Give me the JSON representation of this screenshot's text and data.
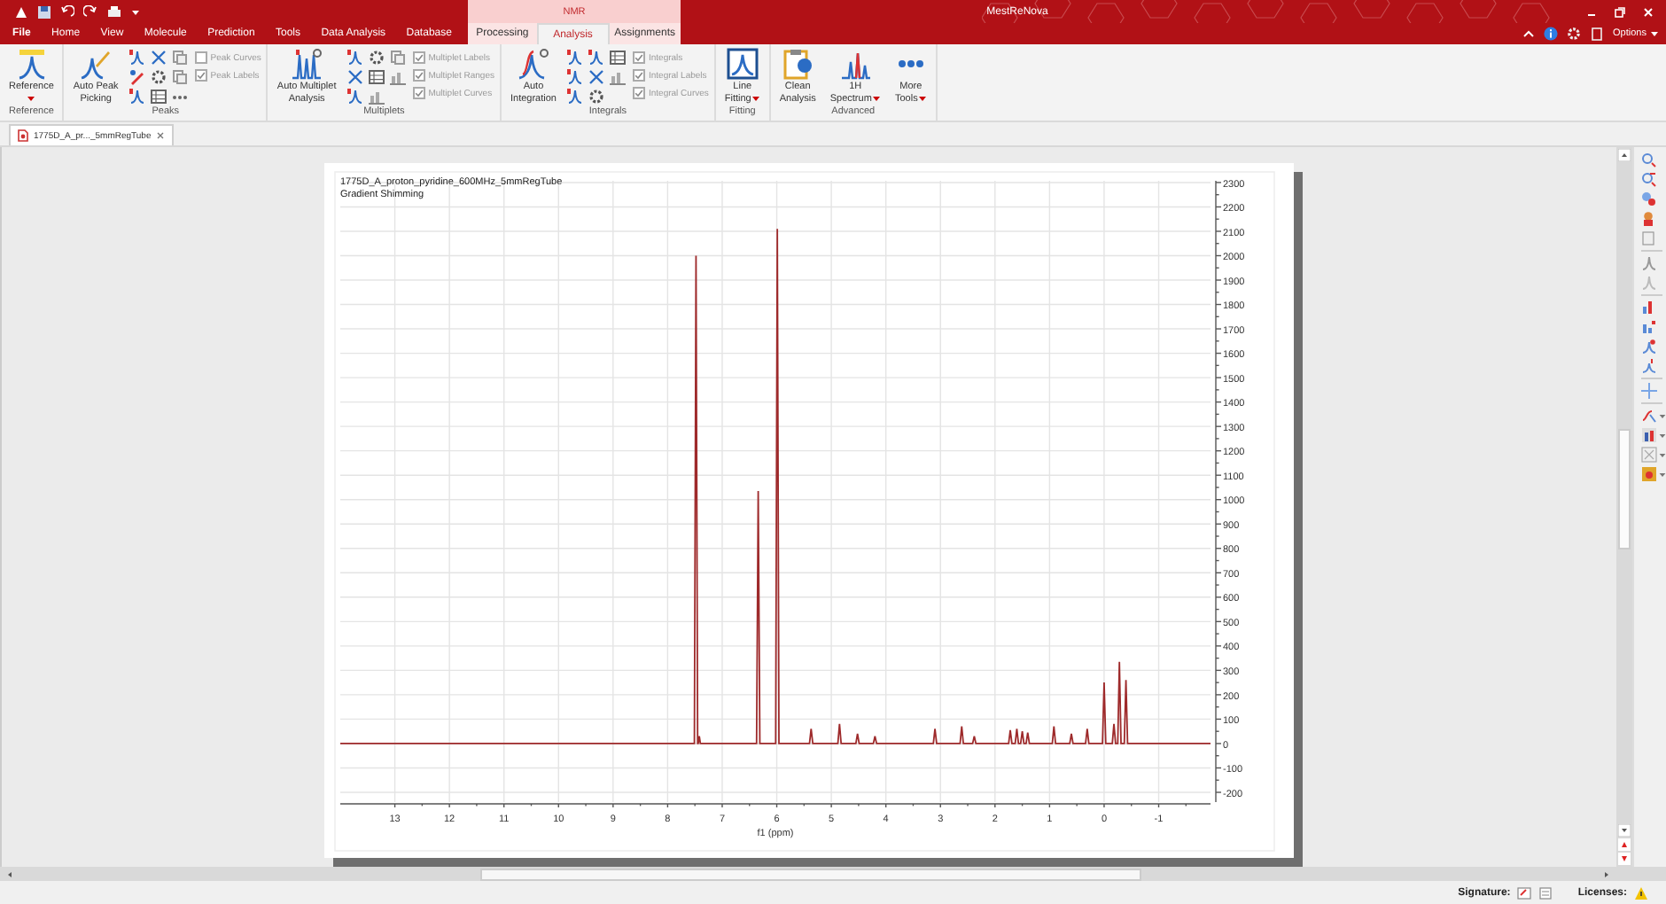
{
  "window": {
    "title": "MestReNova"
  },
  "context_group": {
    "label": "NMR"
  },
  "tabs": [
    {
      "label": "File",
      "kind": "file",
      "selected": false
    },
    {
      "label": "Home",
      "kind": "main",
      "selected": false
    },
    {
      "label": "View",
      "kind": "main",
      "selected": false
    },
    {
      "label": "Molecule",
      "kind": "main",
      "selected": false
    },
    {
      "label": "Prediction",
      "kind": "main",
      "selected": false
    },
    {
      "label": "Tools",
      "kind": "main",
      "selected": false
    },
    {
      "label": "Data Analysis",
      "kind": "main",
      "selected": false
    },
    {
      "label": "Database",
      "kind": "main",
      "selected": false
    },
    {
      "label": "Processing",
      "kind": "context",
      "selected": false
    },
    {
      "label": "Analysis",
      "kind": "context",
      "selected": true
    },
    {
      "label": "Assignments",
      "kind": "context",
      "selected": false
    }
  ],
  "options_button": {
    "label": "Options"
  },
  "ribbon": [
    {
      "label": "Reference",
      "items": [
        {
          "kind": "big",
          "lines": [
            "Reference"
          ],
          "dropdown": true
        }
      ]
    },
    {
      "label": "Peaks",
      "items": [
        {
          "kind": "big",
          "lines": [
            "Auto Peak",
            "Picking"
          ],
          "dropdown": false
        },
        {
          "kind": "icons"
        },
        {
          "kind": "checks",
          "boxes": [
            {
              "label": "Peak Curves",
              "checked": false
            },
            {
              "label": "Peak Labels",
              "checked": true
            }
          ]
        }
      ]
    },
    {
      "label": "Multiplets",
      "items": [
        {
          "kind": "big",
          "lines": [
            "Auto Multiplet",
            "Analysis"
          ],
          "dropdown": false
        },
        {
          "kind": "icons"
        },
        {
          "kind": "checks",
          "boxes": [
            {
              "label": "Multiplet Labels",
              "checked": true
            },
            {
              "label": "Multiplet Ranges",
              "checked": true
            },
            {
              "label": "Multiplet Curves",
              "checked": true
            }
          ]
        }
      ]
    },
    {
      "label": "Integrals",
      "items": [
        {
          "kind": "big",
          "lines": [
            "Auto",
            "Integration"
          ],
          "dropdown": false
        },
        {
          "kind": "icons"
        },
        {
          "kind": "checks",
          "boxes": [
            {
              "label": "Integrals",
              "checked": true
            },
            {
              "label": "Integral Labels",
              "checked": true
            },
            {
              "label": "Integral Curves",
              "checked": true
            }
          ]
        }
      ]
    },
    {
      "label": "Fitting",
      "items": [
        {
          "kind": "big",
          "lines": [
            "Line",
            "Fitting"
          ],
          "dropdown": true
        }
      ]
    },
    {
      "label": "Advanced",
      "items": [
        {
          "kind": "big",
          "lines": [
            "Clean",
            "Analysis"
          ],
          "dropdown": false
        },
        {
          "kind": "big",
          "lines": [
            "1H",
            "Spectrum"
          ],
          "dropdown": true
        },
        {
          "kind": "big",
          "lines": [
            "More",
            "Tools"
          ],
          "dropdown": true
        }
      ]
    }
  ],
  "document_tab": {
    "label": "1775D_A_pr..._5mmRegTube",
    "selected": true
  },
  "spectrum": {
    "title": "1775D_A_proton_pyridine_600MHz_5mmRegTube",
    "subtitle": "Gradient Shimming",
    "chart_data": {
      "type": "line",
      "xlabel": "f1 (ppm)",
      "grid": true,
      "x": [
        14,
        7.51,
        7.48,
        7.45,
        7.44,
        7.42,
        7.4,
        6.37,
        6.34,
        6.31,
        6.02,
        5.99,
        5.96,
        5.4,
        5.37,
        5.34,
        4.88,
        4.85,
        4.82,
        4.55,
        4.52,
        4.49,
        4.23,
        4.2,
        4.17,
        3.13,
        3.1,
        3.07,
        2.64,
        2.61,
        2.58,
        2.41,
        2.38,
        2.35,
        1.75,
        1.72,
        1.69,
        1.63,
        1.6,
        1.57,
        1.53,
        1.5,
        1.47,
        1.43,
        1.4,
        1.37,
        0.95,
        0.92,
        0.89,
        0.63,
        0.6,
        0.57,
        0.34,
        0.31,
        0.28,
        0.03,
        0,
        -0.03,
        -0.15,
        -0.18,
        -0.21,
        -0.25,
        -0.28,
        -0.31,
        -0.37,
        -0.4,
        -0.43,
        -1.95
      ],
      "series": [
        {
          "color": "#9e2a2b",
          "values": [
            0,
            0,
            2000,
            0,
            0,
            30,
            0,
            0,
            1035,
            0,
            0,
            2110,
            0,
            0,
            60,
            0,
            0,
            80,
            0,
            0,
            40,
            0,
            0,
            30,
            0,
            0,
            60,
            0,
            0,
            70,
            0,
            0,
            30,
            0,
            0,
            55,
            0,
            0,
            60,
            0,
            0,
            50,
            0,
            0,
            45,
            0,
            0,
            70,
            0,
            0,
            40,
            0,
            0,
            60,
            0,
            0,
            250,
            0,
            0,
            80,
            0,
            0,
            335,
            0,
            0,
            260,
            0,
            0
          ]
        }
      ],
      "xlim": [
        14,
        -1.95
      ],
      "ylim": [
        -240,
        2307
      ],
      "xticks": [
        13,
        12,
        11,
        10,
        9,
        8,
        7,
        6,
        5,
        4,
        3,
        2,
        1,
        0,
        -1
      ],
      "yticks": [
        -200,
        -100,
        0,
        100,
        200,
        300,
        400,
        500,
        600,
        700,
        800,
        900,
        1000,
        1100,
        1200,
        1300,
        1400,
        1500,
        1600,
        1700,
        1800,
        1900,
        2000,
        2100,
        2200,
        2300
      ]
    }
  },
  "status_bar": {
    "signature": "Signature:",
    "licenses": "Licenses:"
  }
}
